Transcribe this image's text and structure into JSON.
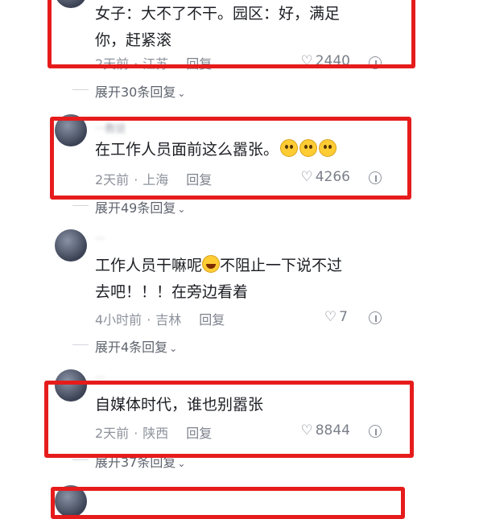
{
  "comments": [
    {
      "text_lines": [
        "女子：大不了不干。园区：好，满足",
        "你，赶紧滚"
      ],
      "time": "2天前",
      "location": "江苏",
      "reply_label": "回复",
      "likes": "2440",
      "expand_label": "展开30条回复"
    },
    {
      "username": "···教徒",
      "text_lines": [
        "在工作人员面前这么嚣张。"
      ],
      "time": "2天前",
      "location": "上海",
      "reply_label": "回复",
      "likes": "4266",
      "expand_label": "展开49条回复"
    },
    {
      "username": "···",
      "text_lines": [
        "工作人员干嘛呢",
        "不阻止一下说不过",
        "去吧！！！在旁边看着"
      ],
      "time": "4小时前",
      "location": "吉林",
      "reply_label": "回复",
      "likes": "7",
      "expand_label": "展开4条回复"
    },
    {
      "username": "···",
      "text_lines": [
        "自媒体时代，谁也别嚣张"
      ],
      "time": "2天前",
      "location": "陕西",
      "reply_label": "回复",
      "likes": "8844",
      "expand_label": "展开37条回复"
    }
  ],
  "sep": "·",
  "colors": {
    "highlight": "#e61c1c"
  }
}
